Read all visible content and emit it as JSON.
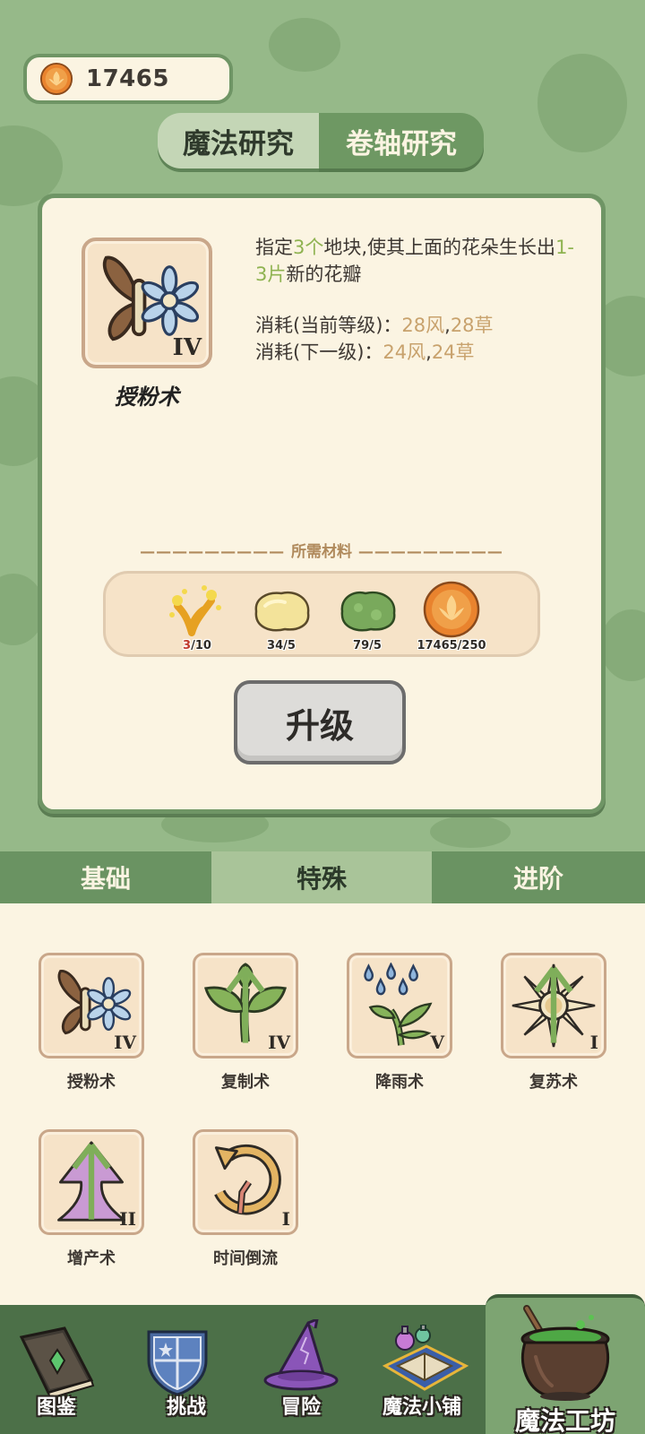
{
  "currency": {
    "amount": "17465"
  },
  "research_tabs": [
    {
      "label": "魔法研究",
      "active": true
    },
    {
      "label": "卷轴研究",
      "active": false
    }
  ],
  "spell_detail": {
    "name": "授粉术",
    "level": "IV",
    "desc_parts": [
      "指定",
      "3个",
      "地块,使其上面的花朵生长出",
      "1-3片",
      "新的花瓣"
    ],
    "cost_current_label": "消耗(当前等级)：",
    "cost_current_wind": "28风",
    "cost_current_grass": "28草",
    "cost_next_label": "消耗(下一级)：",
    "cost_next_wind": "24风",
    "cost_next_grass": "24草",
    "separator": ",",
    "materials_title": "所需材料",
    "materials": [
      {
        "name": "pollen-material",
        "count_have": "3",
        "count_need": "/10"
      },
      {
        "name": "yellow-slime-material",
        "count": "34/5"
      },
      {
        "name": "green-slime-material",
        "count": "79/5"
      },
      {
        "name": "coin-material",
        "count": "17465/250"
      }
    ],
    "upgrade_label": "升级"
  },
  "category_tabs": [
    {
      "label": "基础",
      "active": false
    },
    {
      "label": "特殊",
      "active": true
    },
    {
      "label": "进阶",
      "active": false
    }
  ],
  "spells": [
    {
      "label": "授粉术",
      "level": "IV",
      "upgradable": false
    },
    {
      "label": "复制术",
      "level": "IV",
      "upgradable": true
    },
    {
      "label": "降雨术",
      "level": "V",
      "upgradable": false
    },
    {
      "label": "复苏术",
      "level": "I",
      "upgradable": true
    },
    {
      "label": "增产术",
      "level": "II",
      "upgradable": true
    },
    {
      "label": "时间倒流",
      "level": "I",
      "upgradable": false
    }
  ],
  "nav": [
    {
      "label": "图鉴"
    },
    {
      "label": "挑战"
    },
    {
      "label": "冒险"
    },
    {
      "label": "魔法小铺"
    },
    {
      "label": "魔法工坊",
      "active": true
    }
  ],
  "colors": {
    "background": "#95b887",
    "card": "#fbf4e2",
    "accent_green": "#8fb351",
    "accent_tan": "#c8a26d",
    "nav_bg": "#4c7048"
  }
}
